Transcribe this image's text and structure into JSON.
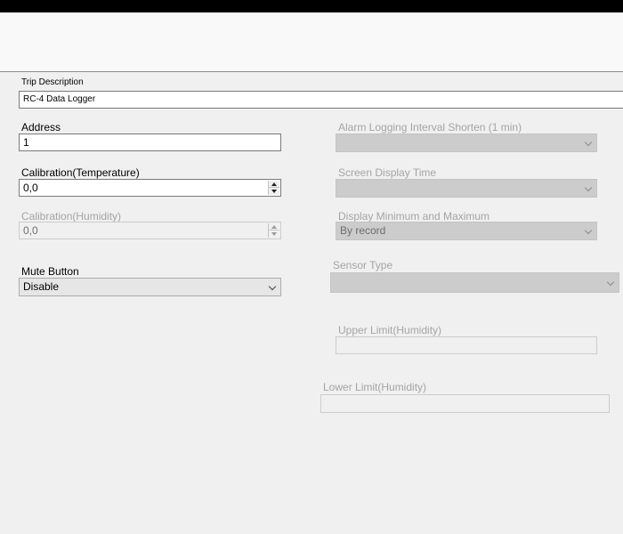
{
  "trip_description": {
    "label": "Trip Description",
    "value": "RC-4 Data Logger"
  },
  "address": {
    "label": "Address",
    "value": "1"
  },
  "calibration_temperature": {
    "label": "Calibration(Temperature)",
    "value": "0,0"
  },
  "calibration_humidity": {
    "label": "Calibration(Humidity)",
    "value": "0,0"
  },
  "mute_button": {
    "label": "Mute Button",
    "value": "Disable"
  },
  "alarm_logging_interval": {
    "label": "Alarm Logging Interval Shorten (1 min)",
    "value": ""
  },
  "screen_display_time": {
    "label": "Screen Display Time",
    "value": ""
  },
  "display_min_max": {
    "label": "Display Minimum and Maximum",
    "value": "By record"
  },
  "sensor_type": {
    "label": "Sensor Type",
    "value": ""
  },
  "upper_limit_humidity": {
    "label": "Upper Limit(Humidity)",
    "value": ""
  },
  "lower_limit_humidity": {
    "label": "Lower Limit(Humidity)",
    "value": ""
  },
  "icons": {
    "dropdown": "chevron-down-icon",
    "spin_up": "spin-up-icon",
    "spin_down": "spin-down-icon"
  },
  "colors": {
    "background": "#f0f0f0",
    "disabled_text": "#a4a4a4",
    "header_bar": "#000000"
  }
}
